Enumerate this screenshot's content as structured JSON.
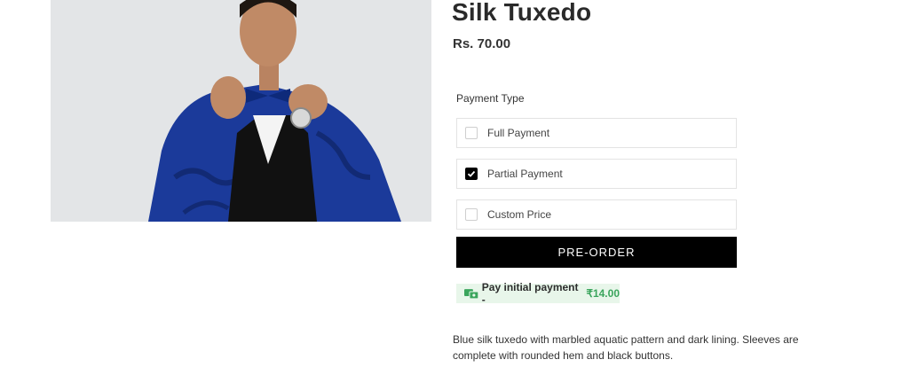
{
  "product": {
    "title": "Silk Tuxedo",
    "price": "Rs. 70.00",
    "image_alt": "Man in blue silk tuxedo adjusting bow tie"
  },
  "payment": {
    "label": "Payment Type",
    "options": [
      {
        "label": "Full Payment",
        "checked": false
      },
      {
        "label": "Partial Payment",
        "checked": true
      },
      {
        "label": "Custom Price",
        "checked": false
      }
    ]
  },
  "actions": {
    "preorder_label": "PRE-ORDER"
  },
  "badge": {
    "icon": "money-icon",
    "text": "Pay initial payment -",
    "amount": "₹14.00",
    "color": "#3aa55c"
  },
  "description": "Blue silk tuxedo with marbled aquatic pattern and dark lining. Sleeves are complete with rounded hem and black buttons."
}
